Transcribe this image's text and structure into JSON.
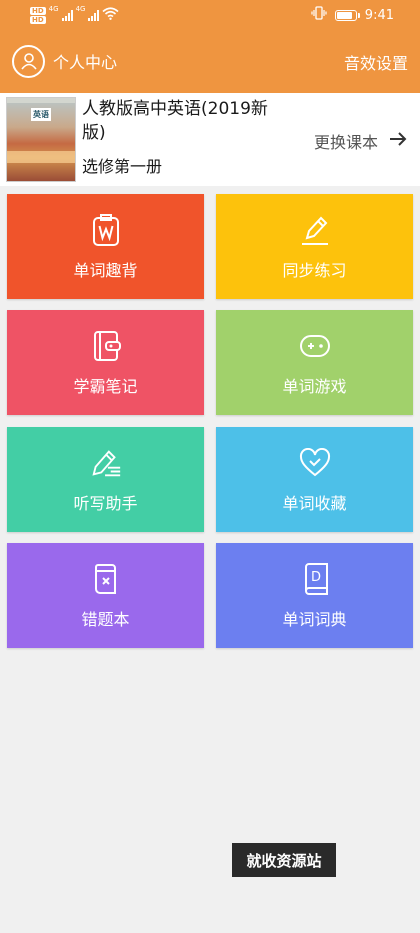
{
  "status_bar": {
    "hd_1": "HD",
    "hd_2": "HD",
    "network_1": "4G",
    "network_2": "4G",
    "time": "9:41",
    "battery_level": 0.85
  },
  "header": {
    "profile_label": "个人中心",
    "settings_label": "音效设置"
  },
  "book": {
    "cover_text": "英语",
    "title": "人教版高中英语(2019新版)",
    "volume": "选修第一册",
    "change_label": "更换课本"
  },
  "tiles": [
    {
      "label": "单词趣背",
      "color": "#f0542b",
      "icon": "word-card-icon"
    },
    {
      "label": "同步练习",
      "color": "#fdc20c",
      "icon": "pencil-icon"
    },
    {
      "label": "学霸笔记",
      "color": "#ef5365",
      "icon": "notebook-icon"
    },
    {
      "label": "单词游戏",
      "color": "#a1d16b",
      "icon": "gamepad-icon"
    },
    {
      "label": "听写助手",
      "color": "#43cea5",
      "icon": "dictation-icon"
    },
    {
      "label": "单词收藏",
      "color": "#4dc0e8",
      "icon": "heart-icon"
    },
    {
      "label": "错题本",
      "color": "#9a69ec",
      "icon": "wrong-book-icon"
    },
    {
      "label": "单词词典",
      "color": "#6c7ff0",
      "icon": "dictionary-icon"
    }
  ],
  "watermark": "就收资源站"
}
